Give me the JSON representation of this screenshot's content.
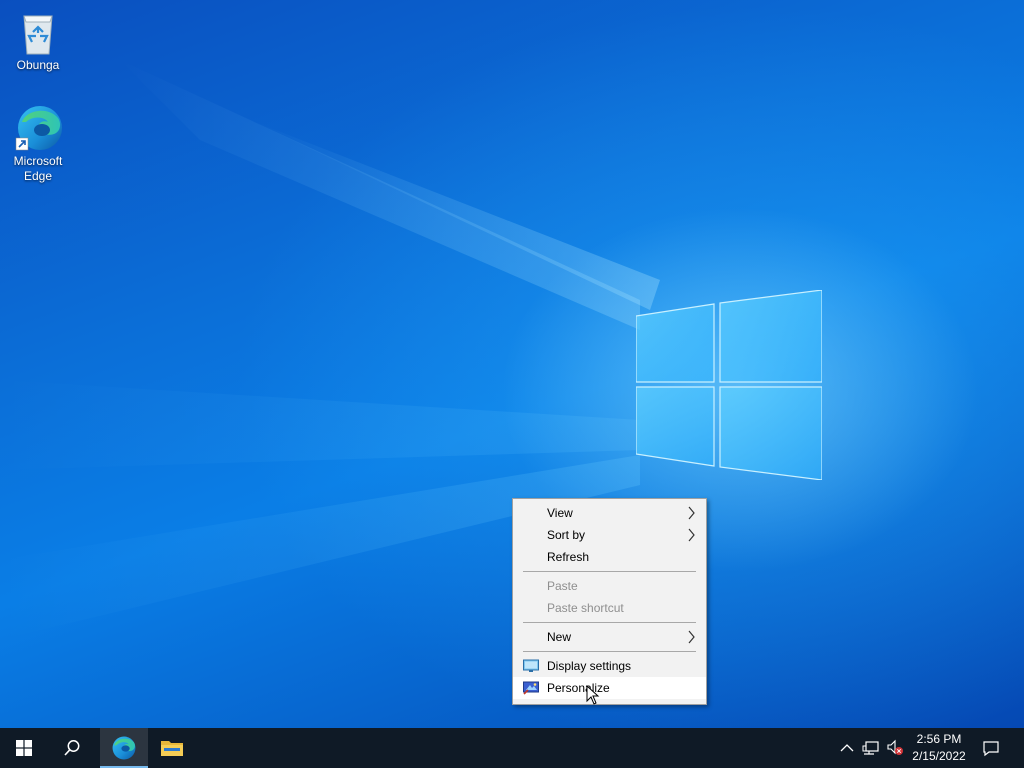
{
  "desktop": {
    "icons": [
      {
        "label": "Obunga",
        "icon": "recycle-bin-icon"
      },
      {
        "label": "Microsoft Edge",
        "icon": "edge-icon",
        "shortcut": true
      }
    ]
  },
  "context_menu": {
    "items": [
      {
        "label": "View",
        "submenu": true,
        "enabled": true
      },
      {
        "label": "Sort by",
        "submenu": true,
        "enabled": true
      },
      {
        "label": "Refresh",
        "submenu": false,
        "enabled": true
      },
      {
        "label": "Paste",
        "submenu": false,
        "enabled": false
      },
      {
        "label": "Paste shortcut",
        "submenu": false,
        "enabled": false
      },
      {
        "label": "New",
        "submenu": true,
        "enabled": true
      },
      {
        "label": "Display settings",
        "icon": "display-settings-icon",
        "enabled": true
      },
      {
        "label": "Personalize",
        "icon": "personalize-icon",
        "enabled": true,
        "hovered": true
      }
    ]
  },
  "taskbar": {
    "buttons": [
      {
        "name": "start",
        "icon": "windows-start-icon"
      },
      {
        "name": "search",
        "icon": "search-icon"
      },
      {
        "name": "edge",
        "icon": "edge-icon",
        "active": true
      },
      {
        "name": "file-explorer",
        "icon": "folder-icon"
      }
    ],
    "tray": {
      "time": "2:56 PM",
      "date": "2/15/2022",
      "icons": [
        "chevron-up-icon",
        "network-icon",
        "volume-muted-icon",
        "notification-icon"
      ]
    }
  },
  "colors": {
    "desktop_accent": "#0a7ee6",
    "taskbar_bg": "#0f1a26",
    "menu_bg": "#f2f2f2",
    "active_indicator": "#76b9ed"
  }
}
